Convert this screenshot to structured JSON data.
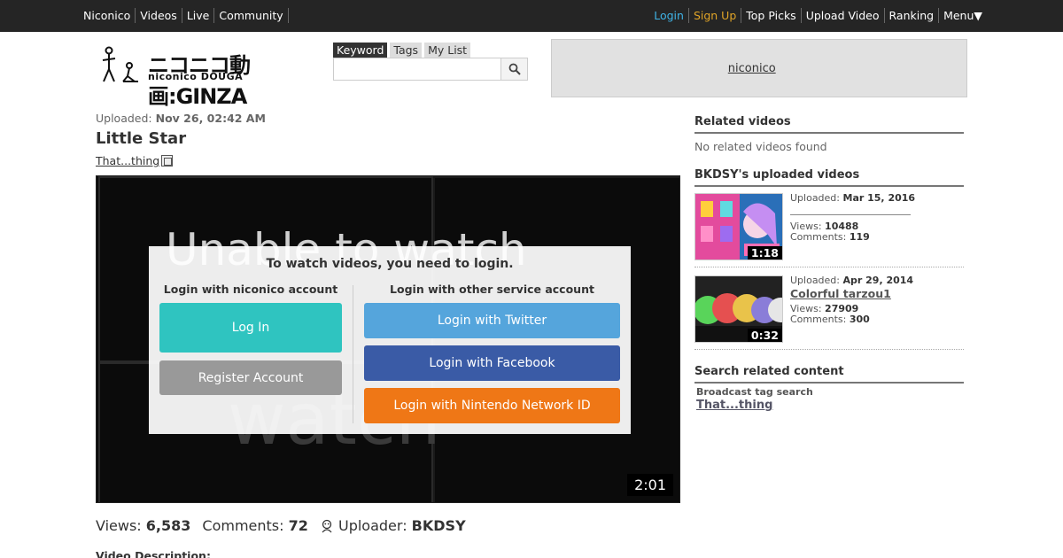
{
  "topbar": {
    "left": [
      "Niconico",
      "Videos",
      "Live",
      "Community"
    ],
    "login": "Login",
    "signup": "Sign Up",
    "right": [
      "Top Picks",
      "Upload Video",
      "Ranking",
      "Menu▼"
    ]
  },
  "logo": {
    "jp": "ニコニコ動画:GINZA",
    "sub": "niconico DOUGA"
  },
  "search": {
    "tabs": [
      "Keyword",
      "Tags",
      "My List"
    ],
    "active_tab": "Keyword",
    "value": ""
  },
  "ad": {
    "link": "niconico"
  },
  "video": {
    "uploaded_label": "Uploaded:",
    "uploaded_date": "Nov 26, 02:42 AM",
    "title": "Little Star",
    "tag": "That...thing",
    "duration": "2:01",
    "bg_text": "Unable to watch",
    "bg_text2": "watch"
  },
  "login_overlay": {
    "heading": "To watch videos, you need to login.",
    "left_title": "Login with niconico account",
    "right_title": "Login with other service account",
    "login_btn": "Log In",
    "register_btn": "Register Account",
    "twitter_btn": "Login with Twitter",
    "facebook_btn": "Login with Facebook",
    "nintendo_btn": "Login with Nintendo Network ID",
    "colors": {
      "login": "#2fc4c0",
      "register": "#999999",
      "twitter": "#55a5dc",
      "facebook": "#3a5ba6",
      "nintendo": "#ef7716"
    }
  },
  "stats": {
    "views_label": "Views:",
    "views": "6,583",
    "comments_label": "Comments:",
    "comments": "72",
    "uploader_label": "Uploader:",
    "uploader": "BKDSY"
  },
  "description_label": "Video Description:",
  "sidebar": {
    "related_heading": "Related videos",
    "no_related": "No related videos found",
    "uploads_heading": "BKDSY's uploaded videos",
    "videos": [
      {
        "uploaded_label": "Uploaded:",
        "date": "Mar 15, 2016",
        "title": "",
        "views_label": "Views:",
        "views": "10488",
        "comments_label": "Comments:",
        "comments": "119",
        "duration": "1:18"
      },
      {
        "uploaded_label": "Uploaded:",
        "date": "Apr 29, 2014",
        "title": "Colorful tarzou1",
        "views_label": "Views:",
        "views": "27909",
        "comments_label": "Comments:",
        "comments": "300",
        "duration": "0:32"
      }
    ],
    "search_heading": "Search related content",
    "broadcast_label": "Broadcast tag search",
    "broadcast_tag": "That...thing"
  }
}
